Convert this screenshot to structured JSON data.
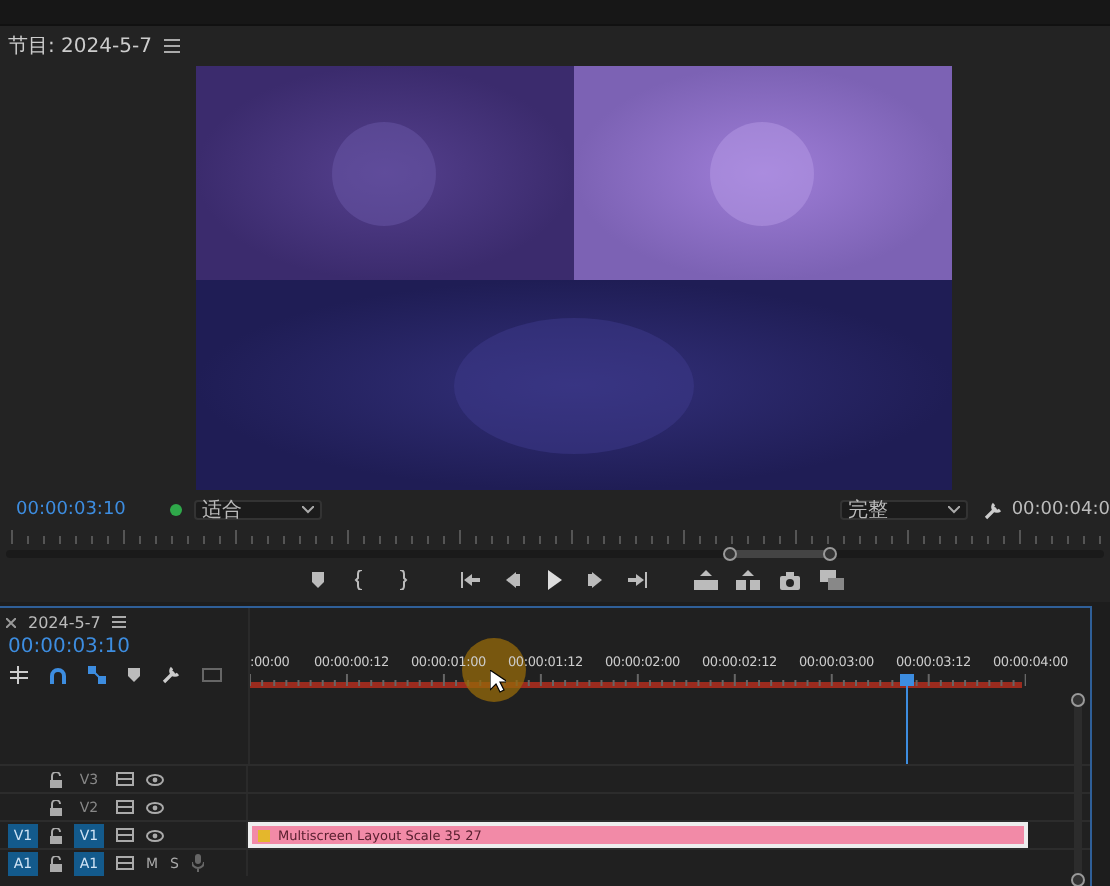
{
  "program_monitor": {
    "title": "节目: 2024-5-7",
    "timecode": "00:00:03:10",
    "zoom": "适合",
    "quality": "完整",
    "duration": "00:00:04:0"
  },
  "timeline": {
    "tab": "2024-5-7",
    "timecode": "00:00:03:10",
    "ruler": [
      ":00:00",
      "00:00:00:12",
      "00:00:01:00",
      "00:00:01:12",
      "00:00:02:00",
      "00:00:02:12",
      "00:00:03:00",
      "00:00:03:12",
      "00:00:04:00"
    ],
    "playhead": {
      "level": 0.83
    },
    "tracks": [
      {
        "kind": "video",
        "name": "V3",
        "targeted": false
      },
      {
        "kind": "video",
        "name": "V2",
        "targeted": false
      },
      {
        "kind": "video",
        "source": "V1",
        "name": "V1",
        "targeted": true,
        "clip": "Multiscreen Layout Scale 35 27"
      },
      {
        "kind": "audio",
        "source": "A1",
        "name": "A1",
        "targeted": true,
        "mute": "M",
        "solo": "S"
      }
    ]
  }
}
